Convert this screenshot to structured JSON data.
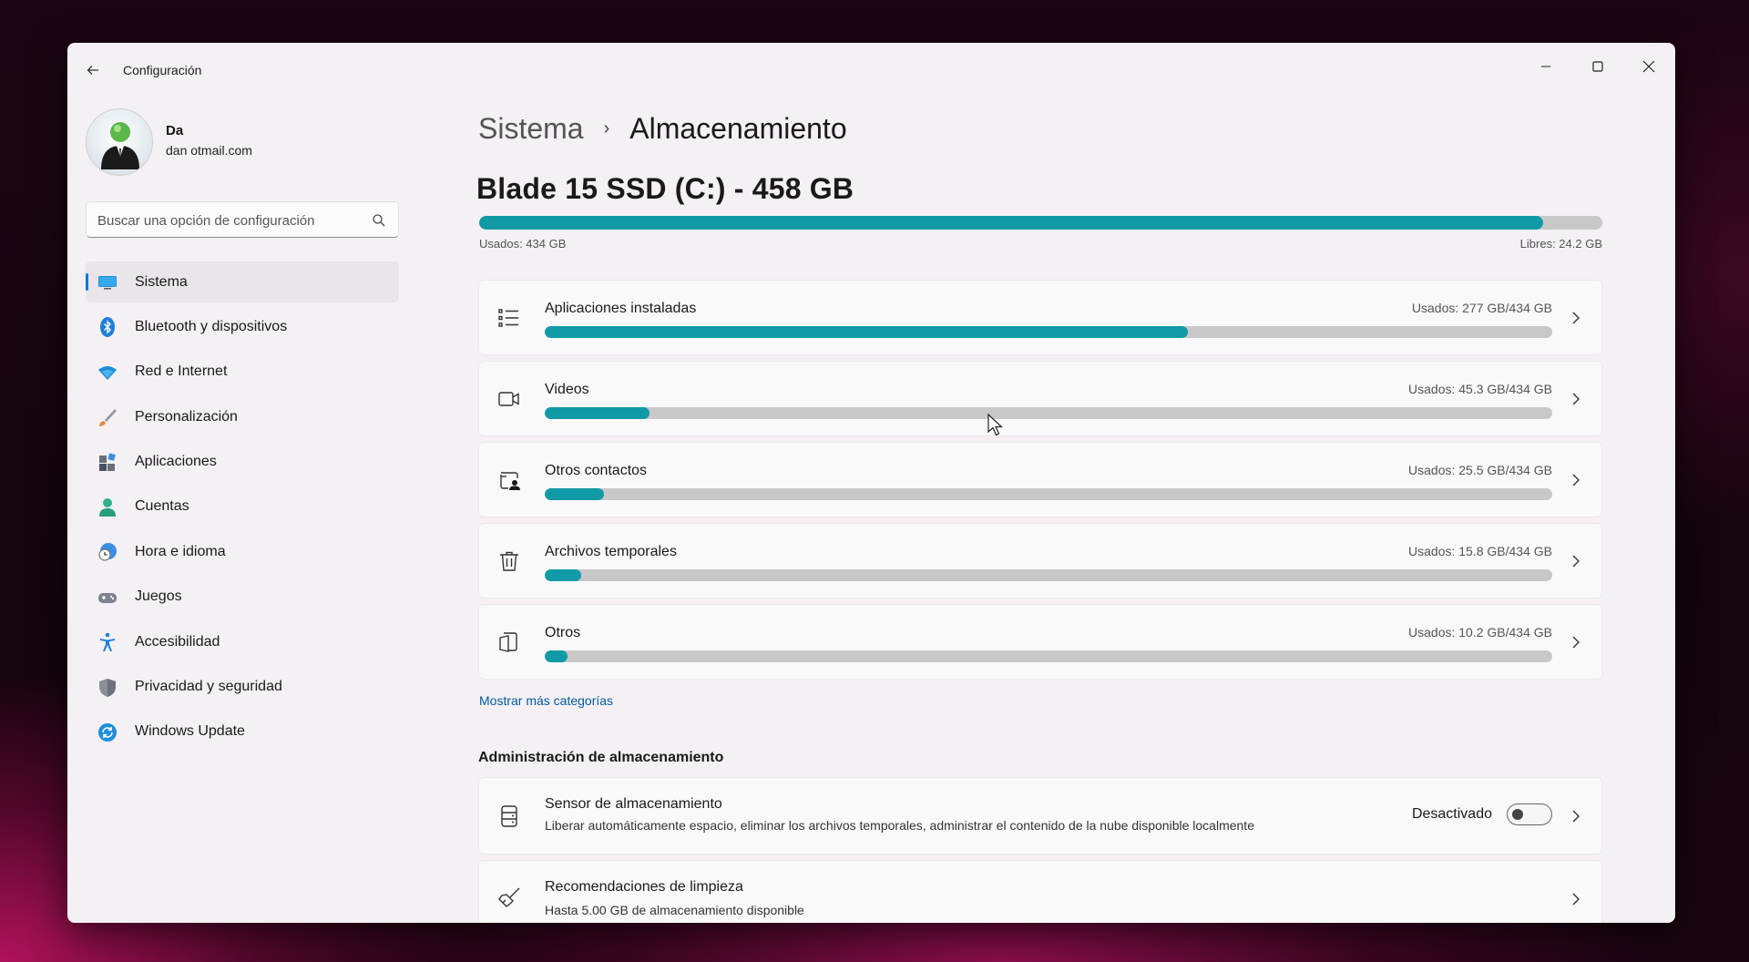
{
  "window": {
    "title": "Configuración"
  },
  "profile": {
    "name": "Da",
    "email": "dan                    otmail.com"
  },
  "search": {
    "placeholder": "Buscar una opción de configuración"
  },
  "sidebar": {
    "items": [
      {
        "label": "Sistema",
        "icon": "monitor-icon",
        "active": true
      },
      {
        "label": "Bluetooth y dispositivos",
        "icon": "bluetooth-icon"
      },
      {
        "label": "Red e Internet",
        "icon": "wifi-icon"
      },
      {
        "label": "Personalización",
        "icon": "brush-icon"
      },
      {
        "label": "Aplicaciones",
        "icon": "apps-icon"
      },
      {
        "label": "Cuentas",
        "icon": "person-icon"
      },
      {
        "label": "Hora e idioma",
        "icon": "clock-globe-icon"
      },
      {
        "label": "Juegos",
        "icon": "gamepad-icon"
      },
      {
        "label": "Accesibilidad",
        "icon": "accessibility-icon"
      },
      {
        "label": "Privacidad y seguridad",
        "icon": "shield-icon"
      },
      {
        "label": "Windows Update",
        "icon": "sync-icon"
      }
    ]
  },
  "breadcrumb": {
    "parent": "Sistema",
    "separator": "›",
    "current": "Almacenamiento"
  },
  "drive": {
    "title": "Blade 15 SSD (C:) - 458 GB",
    "used_label": "Usados: 434 GB",
    "free_label": "Libres: 24.2 GB",
    "used_fraction": 0.947
  },
  "categories": [
    {
      "label": "Aplicaciones instaladas",
      "used": "Usados: 277 GB/434 GB",
      "fraction": 0.638,
      "icon": "list-icon"
    },
    {
      "label": "Videos",
      "used": "Usados: 45.3 GB/434 GB",
      "fraction": 0.104,
      "icon": "video-camera-icon"
    },
    {
      "label": "Otros contactos",
      "used": "Usados: 25.5 GB/434 GB",
      "fraction": 0.059,
      "icon": "contact-card-icon"
    },
    {
      "label": "Archivos temporales",
      "used": "Usados: 15.8 GB/434 GB",
      "fraction": 0.036,
      "icon": "trash-icon"
    },
    {
      "label": "Otros",
      "used": "Usados: 10.2 GB/434 GB",
      "fraction": 0.023,
      "icon": "document-icon"
    }
  ],
  "more_link": "Mostrar más categorías",
  "management": {
    "title": "Administración de almacenamiento",
    "sensor": {
      "title": "Sensor de almacenamiento",
      "desc": "Liberar automáticamente espacio, eliminar los archivos temporales, administrar el contenido de la nube disponible localmente",
      "toggle_label": "Desactivado",
      "enabled": false
    },
    "cleanup": {
      "title": "Recomendaciones de limpieza",
      "desc": "Hasta 5.00 GB de almacenamiento disponible"
    }
  },
  "colors": {
    "accent": "#0078d4",
    "bar_fill": "#0f9aa6",
    "bar_track": "#c8c8c8",
    "link": "#005a9e"
  }
}
